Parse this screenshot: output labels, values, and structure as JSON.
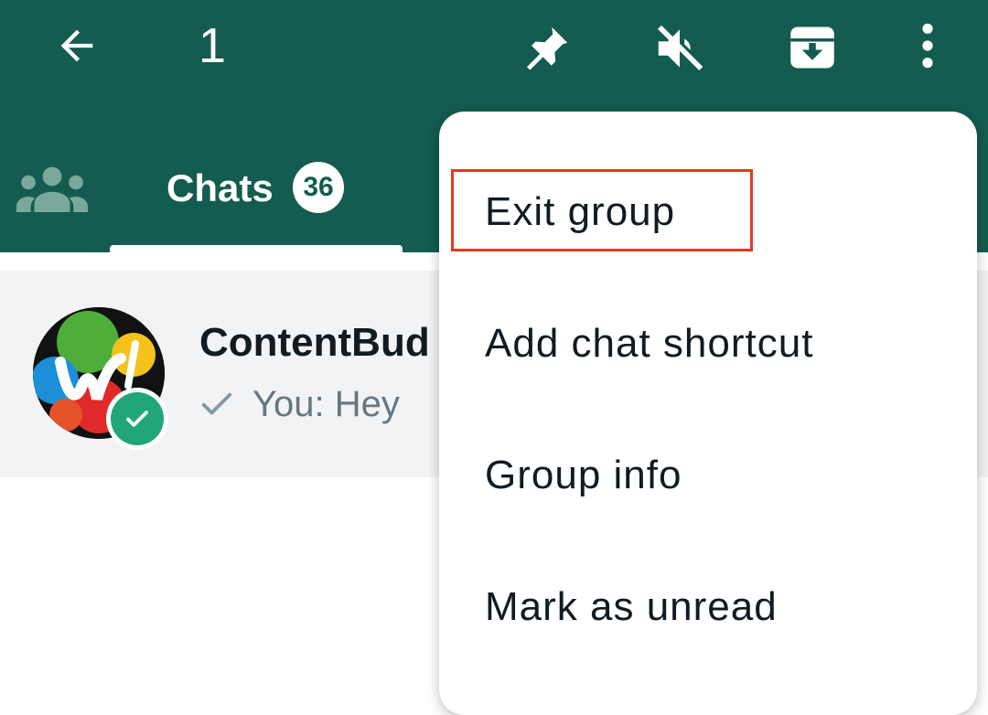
{
  "appbar": {
    "selected_count": "1",
    "icons": [
      "back-arrow-icon",
      "pin-icon",
      "mute-icon",
      "archive-icon",
      "more-vert-icon"
    ],
    "color": "#135c4f"
  },
  "tabs": {
    "community_icon": "community-icon",
    "chats_label": "Chats",
    "chats_badge": "36"
  },
  "chat": {
    "name": "ContentBud",
    "preview": "You: Hey",
    "status_icon": "single-check-icon"
  },
  "menu": {
    "items": [
      {
        "label": "Exit group",
        "highlighted": true
      },
      {
        "label": "Add chat shortcut"
      },
      {
        "label": "Group info"
      },
      {
        "label": "Mark as unread"
      }
    ],
    "highlight_color": "#e5391b"
  }
}
